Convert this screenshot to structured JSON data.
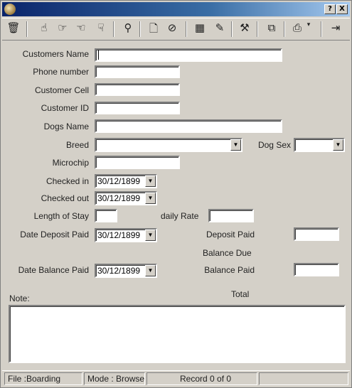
{
  "window": {
    "help_button": "?",
    "close_button": "X"
  },
  "toolbar": {
    "icons": [
      "trash-icon",
      "hand-up-icon",
      "hand-right-icon",
      "hand-left-icon",
      "hand-down-icon",
      "search-icon",
      "new-page-icon",
      "cancel-icon",
      "calendar-icon",
      "attach-icon",
      "tools-icon",
      "copy-icon",
      "print-icon",
      "exit-icon"
    ]
  },
  "form": {
    "customers_name_label": "Customers Name",
    "customers_name_value": "",
    "phone_number_label": "Phone number",
    "phone_number_value": "",
    "customer_cell_label": "Customer Cell",
    "customer_cell_value": "",
    "customer_id_label": "Customer ID",
    "customer_id_value": "",
    "dogs_name_label": "Dogs Name",
    "dogs_name_value": "",
    "breed_label": "Breed",
    "breed_value": "",
    "dog_sex_label": "Dog Sex",
    "dog_sex_value": "",
    "microchip_label": "Microchip",
    "microchip_value": "",
    "checked_in_label": "Checked in",
    "checked_in_value": "30/12/1899",
    "checked_out_label": "Checked out",
    "checked_out_value": "30/12/1899",
    "length_of_stay_label": "Length of Stay",
    "length_of_stay_value": "",
    "daily_rate_label": "daily Rate",
    "daily_rate_value": "",
    "date_deposit_paid_label": "Date Deposit Paid",
    "date_deposit_paid_value": "30/12/1899",
    "deposit_paid_label": "Deposit Paid",
    "deposit_paid_value": "",
    "balance_due_label": "Balance Due",
    "date_balance_paid_label": "Date Balance Paid",
    "date_balance_paid_value": "30/12/1899",
    "balance_paid_label": "Balance Paid",
    "balance_paid_value": "",
    "total_label": "Total",
    "note_label": "Note:",
    "note_value": ""
  },
  "status_bar": {
    "file": "File :Boarding",
    "mode": "Mode : Browse",
    "record": "Record 0 of 0"
  }
}
